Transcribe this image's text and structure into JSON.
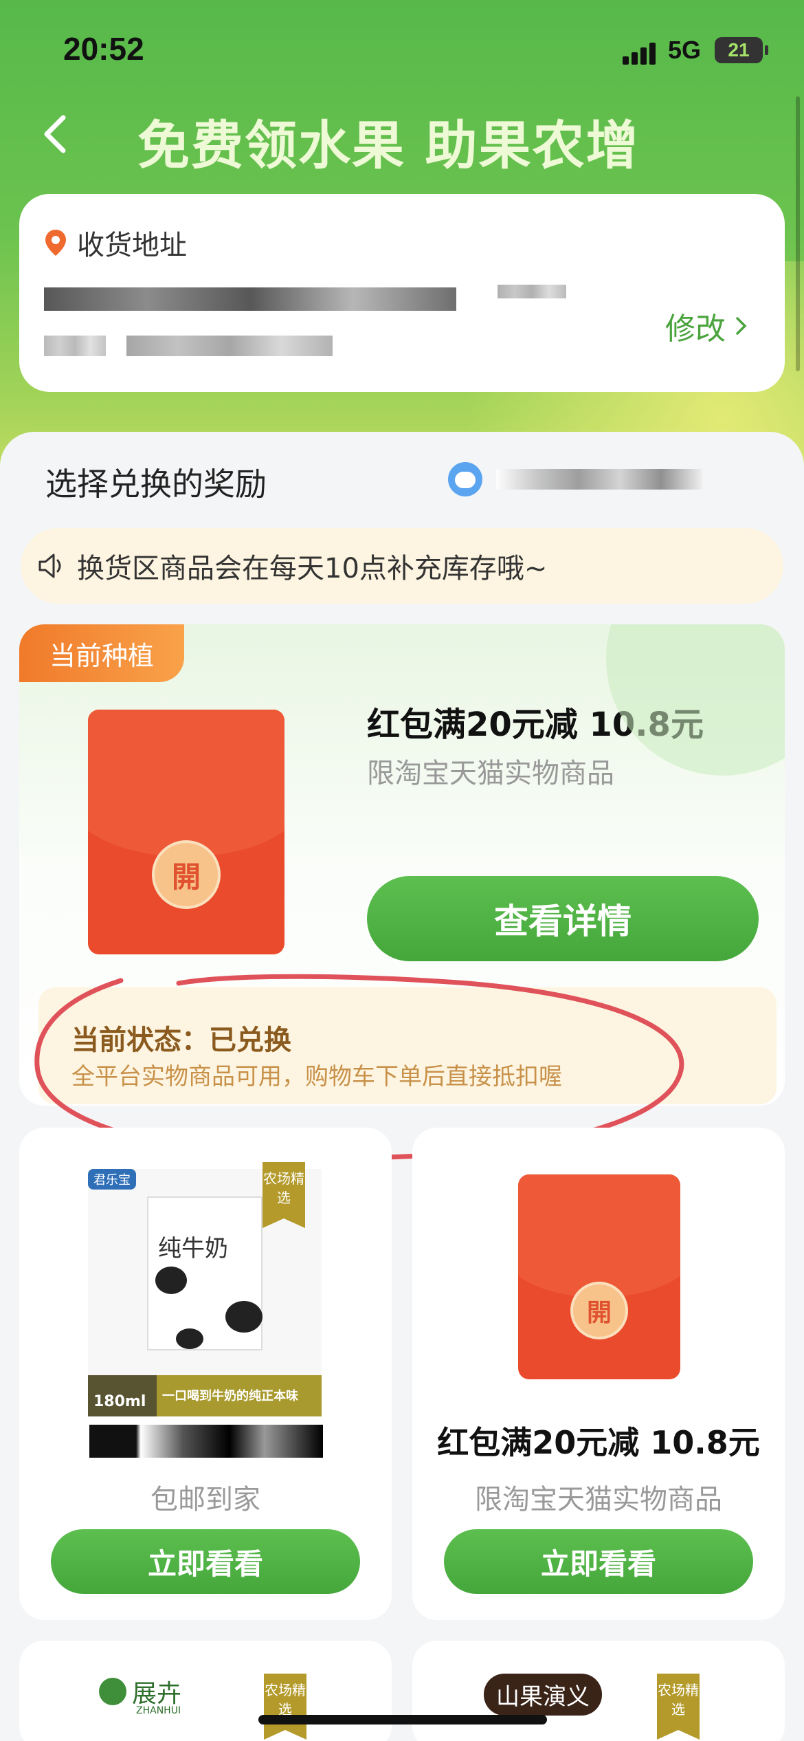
{
  "status_bar": {
    "time": "20:52",
    "network": "5G",
    "battery": "21"
  },
  "header": {
    "title": "免费领水果 助果农增收"
  },
  "address": {
    "label": "收货地址",
    "edit_label": "修改"
  },
  "rewards": {
    "section_title": "选择兑换的奖励"
  },
  "notice": {
    "text": "换货区商品会在每天10点补充库存哦~"
  },
  "current": {
    "tag": "当前种植",
    "seal_char": "開",
    "title": "红包满20元减 10.8元",
    "subtitle": "限淘宝天猫实物商品",
    "button_label": "查看详情",
    "status_label": "当前状态：",
    "status_value": "已兑换",
    "status_desc": "全平台实物商品可用，购物车下单后直接抵扣喔"
  },
  "products": [
    {
      "brand": "君乐宝",
      "farm_tag": "农场精选",
      "pack_text": "纯牛奶",
      "volume": "180ml",
      "slogan": "一口喝到牛奶的纯正本味",
      "subtitle": "包邮到家",
      "button_label": "立即看看"
    },
    {
      "seal_char": "開",
      "title": "红包满20元减 10.8元",
      "subtitle": "限淘宝天猫实物商品",
      "button_label": "立即看看"
    },
    {
      "brand": "展卉",
      "brand_en": "ZHANHUI",
      "farm_tag": "农场精选"
    },
    {
      "brand": "山果演义",
      "farm_tag": "农场精选"
    }
  ],
  "colors": {
    "accent_green": "#4aa33d",
    "tag_orange": "#f07a2a",
    "envelope_red": "#ea4b2c"
  }
}
